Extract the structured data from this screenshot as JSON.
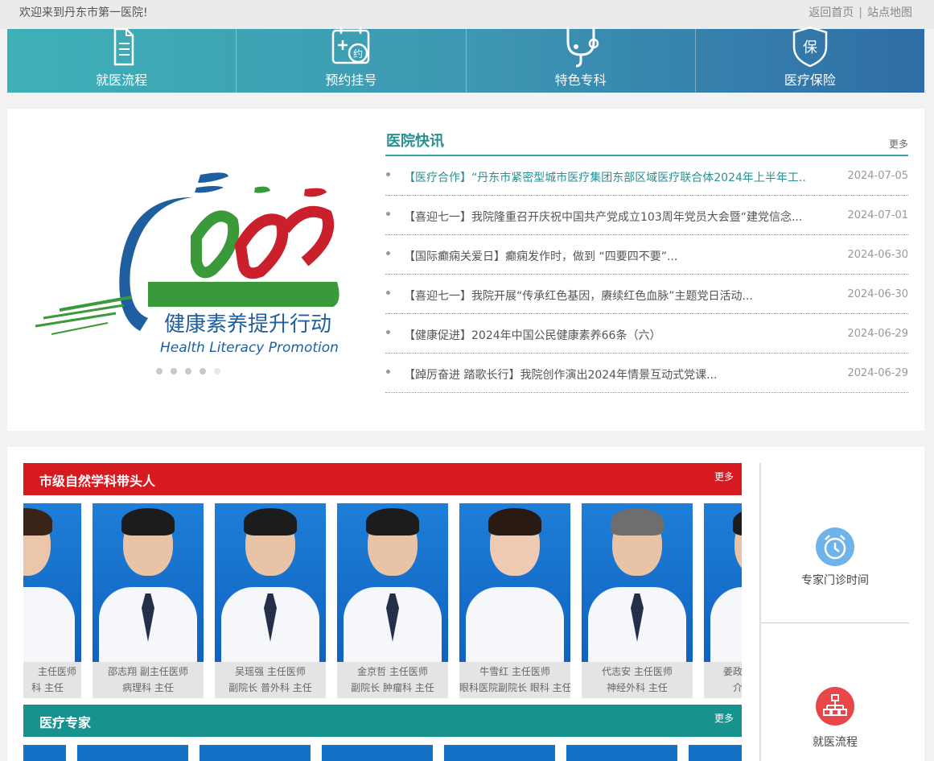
{
  "topbar": {
    "welcome": "欢迎来到丹东市第一医院!",
    "home_link": "返回首页",
    "separator": "|",
    "sitemap_link": "站点地图"
  },
  "nav": [
    {
      "label": "就医流程",
      "icon": "document-icon"
    },
    {
      "label": "预约挂号",
      "icon": "calendar-icon"
    },
    {
      "label": "特色专科",
      "icon": "stethoscope-icon"
    },
    {
      "label": "医疗保险",
      "icon": "shield-icon"
    }
  ],
  "banner": {
    "logo_text_cn": "健康素养提升行动",
    "logo_text_en": "Health Literacy Promotion",
    "dots": 5,
    "active_dot": 0
  },
  "news": {
    "title": "医院快讯",
    "more": "更多",
    "items": [
      {
        "text": "【医疗合作】“丹东市紧密型城市医疗集团东部区域医疗联合体2024年上半年工...",
        "date": "2024-07-05"
      },
      {
        "text": "【喜迎七一】我院隆重召开庆祝中国共产党成立103周年党员大会暨“建党信念...",
        "date": "2024-07-01"
      },
      {
        "text": "【国际癫痫关爱日】癫痫发作时，做到 “四要四不要”...",
        "date": "2024-06-30"
      },
      {
        "text": "【喜迎七一】我院开展“传承红色基因，赓续红色血脉”主题党日活动...",
        "date": "2024-06-30"
      },
      {
        "text": "【健康促进】2024年中国公民健康素养66条（六）",
        "date": "2024-06-29"
      },
      {
        "text": "【踔厉奋进 踏歌长行】我院创作演出2024年情景互动式党课...",
        "date": "2024-06-29"
      }
    ]
  },
  "leaders": {
    "title": "市级自然学科带头人",
    "more": "更多",
    "cards": [
      {
        "line1": "主任医师",
        "line2": "科 主任"
      },
      {
        "line1": "邵志翔 副主任医师",
        "line2": "病理科 主任"
      },
      {
        "line1": "吴瑶强 主任医师",
        "line2": "副院长 普外科 主任"
      },
      {
        "line1": "金京哲 主任医师",
        "line2": "副院长 肿瘤科 主任"
      },
      {
        "line1": "牛雪红 主任医师",
        "line2": "眼科医院副院长 眼科 主任"
      },
      {
        "line1": "代志安 主任医师",
        "line2": "神经外科 主任"
      },
      {
        "line1": "姜政",
        "line2": "介"
      }
    ]
  },
  "experts": {
    "title": "医疗专家",
    "more": "更多"
  },
  "side": [
    {
      "label": "专家门诊时间",
      "icon": "alarm-clock-icon",
      "color": "#6fb3e8"
    },
    {
      "label": "就医流程",
      "icon": "flowchart-icon",
      "color": "#e8474a"
    }
  ]
}
